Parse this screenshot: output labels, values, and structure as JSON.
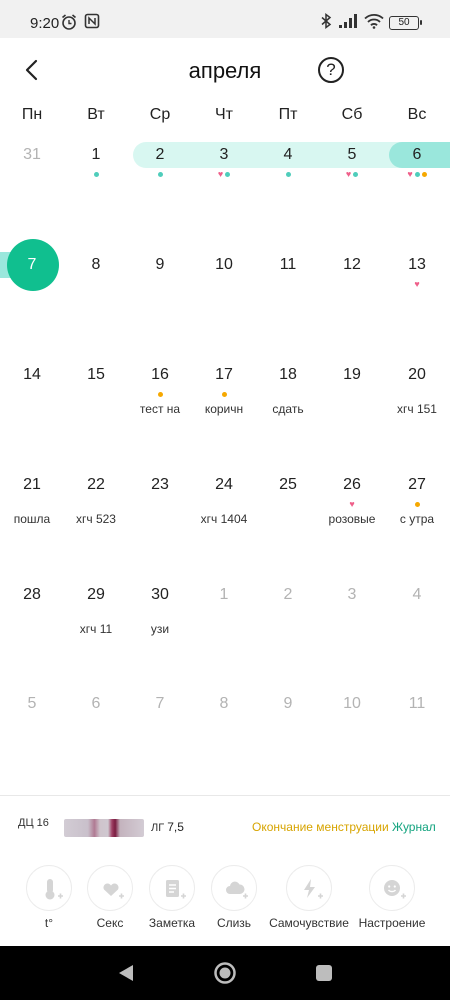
{
  "status_bar": {
    "time": "9:20",
    "battery": "50"
  },
  "header": {
    "month_title": "апреля",
    "help_label": "?"
  },
  "weekdays": [
    "Пн",
    "Вт",
    "Ср",
    "Чт",
    "Пт",
    "Сб",
    "Вс"
  ],
  "weeks": [
    [
      {
        "day": "31",
        "muted": true,
        "marks": []
      },
      {
        "day": "1",
        "marks": [
          "dot-teal"
        ]
      },
      {
        "day": "2",
        "marks": [
          "dot-teal"
        ]
      },
      {
        "day": "3",
        "marks": [
          "heart",
          "dot-teal"
        ]
      },
      {
        "day": "4",
        "marks": [
          "dot-teal"
        ]
      },
      {
        "day": "5",
        "marks": [
          "heart",
          "dot-teal"
        ]
      },
      {
        "day": "6",
        "marks": [
          "heart",
          "dot-teal",
          "dot-orange"
        ]
      }
    ],
    [
      {
        "day": "7",
        "today": true,
        "marks": []
      },
      {
        "day": "8",
        "marks": []
      },
      {
        "day": "9",
        "marks": []
      },
      {
        "day": "10",
        "marks": []
      },
      {
        "day": "11",
        "marks": []
      },
      {
        "day": "12",
        "marks": []
      },
      {
        "day": "13",
        "marks": [
          "heart"
        ]
      }
    ],
    [
      {
        "day": "14",
        "marks": []
      },
      {
        "day": "15",
        "marks": []
      },
      {
        "day": "16",
        "marks": [
          "dot-orange"
        ],
        "note": "тест на"
      },
      {
        "day": "17",
        "marks": [
          "dot-orange"
        ],
        "note": "коричн"
      },
      {
        "day": "18",
        "marks": [],
        "note": "сдать"
      },
      {
        "day": "19",
        "marks": []
      },
      {
        "day": "20",
        "marks": [],
        "note": "хгч 151"
      }
    ],
    [
      {
        "day": "21",
        "marks": [],
        "note": "пошла"
      },
      {
        "day": "22",
        "marks": [],
        "note": "хгч 523"
      },
      {
        "day": "23",
        "marks": []
      },
      {
        "day": "24",
        "marks": [],
        "note": "хгч 1404"
      },
      {
        "day": "25",
        "marks": []
      },
      {
        "day": "26",
        "marks": [
          "heart"
        ],
        "note": "розовые"
      },
      {
        "day": "27",
        "marks": [
          "dot-orange"
        ],
        "note": "с утра"
      }
    ],
    [
      {
        "day": "28",
        "marks": []
      },
      {
        "day": "29",
        "marks": [],
        "note": "хгч 11"
      },
      {
        "day": "30",
        "marks": [],
        "note": "узи"
      },
      {
        "day": "1",
        "muted": true,
        "marks": []
      },
      {
        "day": "2",
        "muted": true,
        "marks": []
      },
      {
        "day": "3",
        "muted": true,
        "marks": []
      },
      {
        "day": "4",
        "muted": true,
        "marks": []
      }
    ],
    [
      {
        "day": "5",
        "muted": true,
        "marks": []
      },
      {
        "day": "6",
        "muted": true,
        "marks": []
      },
      {
        "day": "7",
        "muted": true,
        "marks": []
      },
      {
        "day": "8",
        "muted": true,
        "marks": []
      },
      {
        "day": "9",
        "muted": true,
        "marks": []
      },
      {
        "day": "10",
        "muted": true,
        "marks": []
      },
      {
        "day": "11",
        "muted": true,
        "marks": []
      }
    ]
  ],
  "info_bar": {
    "cycle_day": "ДЦ 16",
    "lh_label": "ЛГ",
    "lh_value": "7,5",
    "end_period_link": "Окончание менструации",
    "journal_link": "Журнал"
  },
  "actions": [
    {
      "label": "t°",
      "icon": "thermometer-icon"
    },
    {
      "label": "Секс",
      "icon": "heart-icon"
    },
    {
      "label": "Заметка",
      "icon": "note-icon"
    },
    {
      "label": "Слизь",
      "icon": "cloud-icon"
    },
    {
      "label": "Самочувствие",
      "icon": "lightning-icon"
    },
    {
      "label": "Настроение",
      "icon": "smiley-icon"
    }
  ],
  "colors": {
    "accent_teal": "#10bf8f",
    "period_band": "#d8f7f1",
    "period_band_strong": "#9ae7dc",
    "heart": "#ef5f8a",
    "orange_dot": "#f6a800",
    "end_period_link": "#d7a400",
    "journal_link": "#12a37e"
  }
}
